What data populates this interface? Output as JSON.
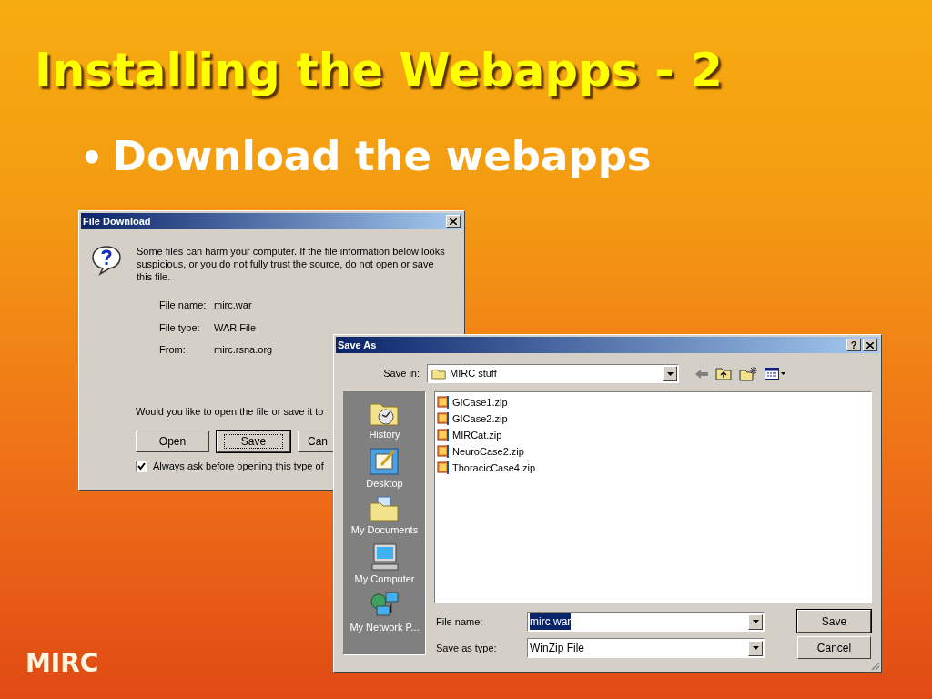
{
  "slide": {
    "title": "Installing the Webapps - 2",
    "bullets": [
      {
        "marker": "•",
        "text": "Download the webapps"
      }
    ],
    "footer": "MIRC"
  },
  "file_download": {
    "title": "File Download",
    "message": "Some files can harm your computer. If the file information below looks suspicious, or you do not fully trust the source, do not open or save this file.",
    "fields": [
      {
        "label": "File name:",
        "value": "mirc.war"
      },
      {
        "label": "File type:",
        "value": "WAR File"
      },
      {
        "label": "From:",
        "value": "mirc.rsna.org"
      }
    ],
    "question": "Would you like to open the file or save it to",
    "buttons": [
      {
        "label": "Open",
        "default": false
      },
      {
        "label": "Save",
        "default": true
      },
      {
        "label": "Can",
        "default": false
      }
    ],
    "checkbox": {
      "label": "Always ask before opening this type of",
      "checked": true
    }
  },
  "save_as": {
    "title": "Save As",
    "help": "?",
    "save_in": {
      "label": "Save in:",
      "value": "MIRC stuff"
    },
    "places": [
      {
        "label": "History",
        "kind": "history"
      },
      {
        "label": "Desktop",
        "kind": "desktop"
      },
      {
        "label": "My Documents",
        "kind": "documents"
      },
      {
        "label": "My Computer",
        "kind": "computer"
      },
      {
        "label": "My Network P...",
        "kind": "network"
      }
    ],
    "files": [
      "GICase1.zip",
      "GICase2.zip",
      "MIRCat.zip",
      "NeuroCase2.zip",
      "ThoracicCase4.zip"
    ],
    "file_name": {
      "label": "File name:",
      "value": "mirc.war",
      "text_selected": true
    },
    "save_as_type": {
      "label": "Save as type:",
      "value": "WinZip File"
    },
    "buttons": [
      {
        "label": "Save",
        "default": true
      },
      {
        "label": "Cancel",
        "default": false
      }
    ]
  }
}
